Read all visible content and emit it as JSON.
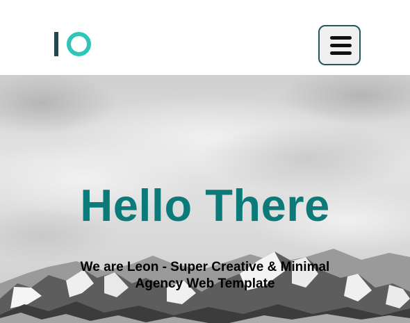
{
  "header": {
    "logo_text": "IO",
    "menu_label": "Menu"
  },
  "hero": {
    "title": "Hello There",
    "subtitle": "We are Leon - Super Creative & Minimal Agency Web Template"
  },
  "colors": {
    "accent": "#0d7a7a",
    "logo_bar": "#22484f",
    "logo_ring": "#2fc5b8",
    "menu_border": "#20585c"
  },
  "icons": {
    "menu": "hamburger-icon"
  }
}
